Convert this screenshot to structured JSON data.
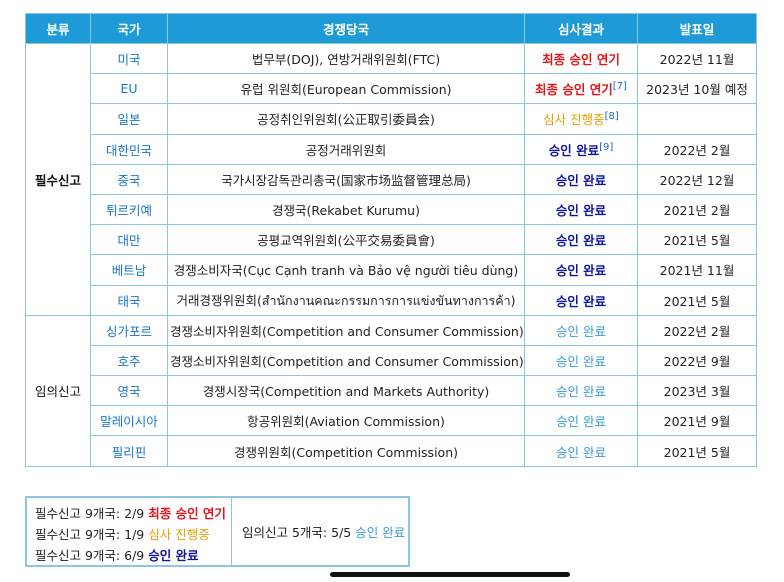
{
  "table": {
    "headers": {
      "category": "분류",
      "country": "국가",
      "authority": "경쟁당국",
      "result": "심사결과",
      "date": "발표일"
    },
    "groups": {
      "required": "필수신고",
      "voluntary": "임의신고"
    },
    "rows": [
      {
        "country": "미국",
        "authority": "법무부(DOJ), 연방거래위원회(FTC)",
        "result": "최종 승인 연기",
        "ref": "",
        "date": "2022년 11월"
      },
      {
        "country": "EU",
        "authority": "유럽 위원회(European Commission)",
        "result": "최종 승인 연기",
        "ref": "[7]",
        "date": "2023년 10월 예정"
      },
      {
        "country": "일본",
        "authority": "공정취인위원회(公正取引委員会)",
        "result": "심사 진행중",
        "ref": "[8]",
        "date": ""
      },
      {
        "country": "대한민국",
        "authority": "공정거래위원회",
        "result": "승인 완료",
        "ref": "[9]",
        "date": "2022년 2월"
      },
      {
        "country": "중국",
        "authority": "국가시장감독관리총국(国家市场监督管理总局)",
        "result": "승인 완료",
        "ref": "",
        "date": "2022년 12월"
      },
      {
        "country": "튀르키예",
        "authority": "경쟁국(Rekabet Kurumu)",
        "result": "승인 완료",
        "ref": "",
        "date": "2021년 2월"
      },
      {
        "country": "대만",
        "authority": "공평교역위원회(公平交易委員會)",
        "result": "승인 완료",
        "ref": "",
        "date": "2021년 5월"
      },
      {
        "country": "베트남",
        "authority": "경쟁소비자국(Cục Cạnh tranh và Bảo vệ người tiêu dùng)",
        "result": "승인 완료",
        "ref": "",
        "date": "2021년 11월"
      },
      {
        "country": "태국",
        "authority": "거래경쟁위원회(สำนักงานคณะกรรมการการแข่งขันทางการค้า)",
        "result": "승인 완료",
        "ref": "",
        "date": "2021년 5월"
      },
      {
        "country": "싱가포르",
        "authority": "경쟁소비자위원회(Competition and Consumer Commission)",
        "result": "승인 완료",
        "ref": "",
        "date": "2022년 2월"
      },
      {
        "country": "호주",
        "authority": "경쟁소비자위원회(Competition and Consumer Commission)",
        "result": "승인 완료",
        "ref": "",
        "date": "2022년 9월"
      },
      {
        "country": "영국",
        "authority": "경쟁시장국(Competition and Markets Authority)",
        "result": "승인 완료",
        "ref": "",
        "date": "2023년 3월"
      },
      {
        "country": "말레이시아",
        "authority": "항공위원회(Aviation Commission)",
        "result": "승인 완료",
        "ref": "",
        "date": "2021년 9월"
      },
      {
        "country": "필리핀",
        "authority": "경쟁위원회(Competition Commission)",
        "result": "승인 완료",
        "ref": "",
        "date": "2021년 5월"
      }
    ]
  },
  "summary": {
    "left": [
      {
        "prefix": "필수신고 9개국: 2/9",
        "status": "최종 승인 연기"
      },
      {
        "prefix": "필수신고 9개국: 1/9",
        "status": "심사 진행중"
      },
      {
        "prefix": "필수신고 9개국: 6/9",
        "status": "승인 완료"
      }
    ],
    "right": {
      "prefix": "임의신고 5개국: 5/5",
      "status": "승인 완료"
    }
  },
  "colors": {
    "header_bg": "#1e9ad6",
    "border": "#8fc6df",
    "country_link": "#1a73c9",
    "final_approval_delayed": "#e0161b",
    "under_review": "#e4a20a",
    "approved_required": "#10169c",
    "approved_voluntary": "#3a9bd6"
  }
}
